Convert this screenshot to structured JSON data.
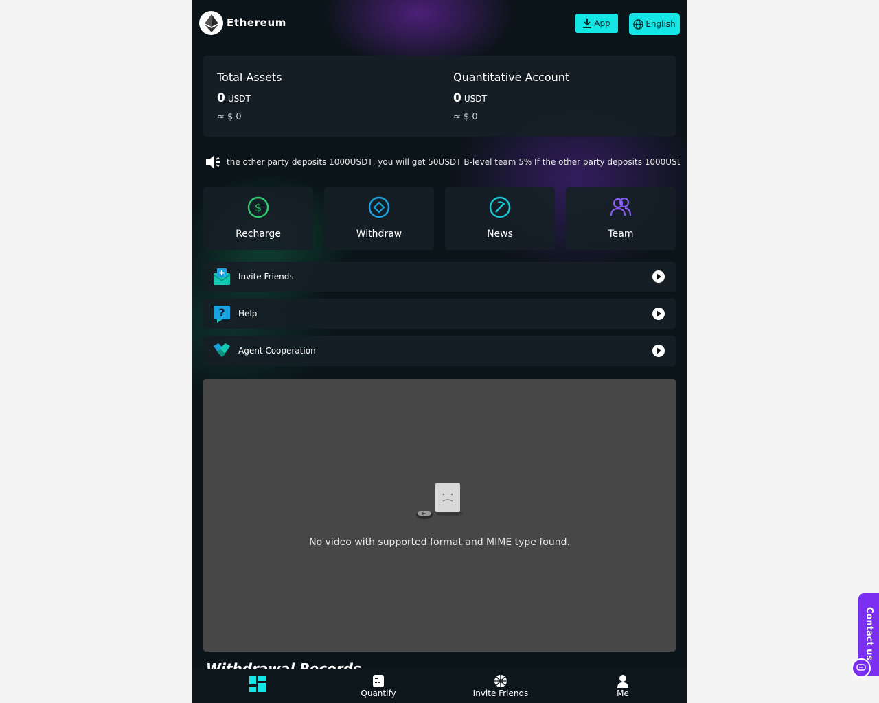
{
  "header": {
    "brand": "Ethereum",
    "app_button": "App",
    "lang_button": "English"
  },
  "assets": {
    "total": {
      "label": "Total Assets",
      "amount": "0",
      "unit": "USDT",
      "approx": "≈ $ 0"
    },
    "quant": {
      "label": "Quantitative Account",
      "amount": "0",
      "unit": "USDT",
      "approx": "≈ $ 0"
    }
  },
  "notice": "the other party deposits 1000USDT, you will get 50USDT B-level team 5% If the other party deposits 1000USDT, you",
  "actions": [
    {
      "label": "Recharge",
      "icon": "recharge-icon",
      "color": "#2ecc71"
    },
    {
      "label": "Withdraw",
      "icon": "withdraw-icon",
      "color": "#1aa3e0"
    },
    {
      "label": "News",
      "icon": "news-icon",
      "color": "#14c9d4"
    },
    {
      "label": "Team",
      "icon": "team-icon",
      "color": "#8a5cf5"
    }
  ],
  "menu": [
    {
      "label": "Invite Friends",
      "icon": "invite-mail-icon"
    },
    {
      "label": "Help",
      "icon": "help-icon"
    },
    {
      "label": "Agent Cooperation",
      "icon": "handshake-icon"
    }
  ],
  "video": {
    "message": "No video with supported format and MIME type found."
  },
  "section_peek": "Withdrawal Records",
  "nav": [
    {
      "label": "",
      "icon": "dashboard-icon",
      "active": true
    },
    {
      "label": "Quantify",
      "icon": "quantify-icon"
    },
    {
      "label": "Invite Friends",
      "icon": "invite-icon"
    },
    {
      "label": "Me",
      "icon": "user-icon"
    }
  ],
  "contact": "Contact us",
  "colors": {
    "accent": "#14e6e6",
    "contact": "#7b2ff0",
    "background": "#0b1418"
  }
}
